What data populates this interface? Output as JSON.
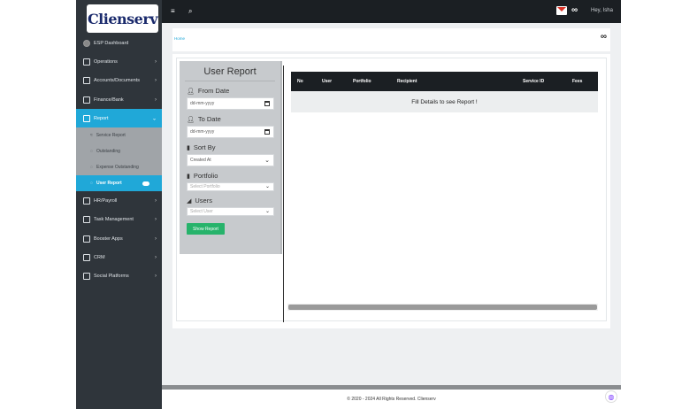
{
  "brand": {
    "logo_text": "Clienserv"
  },
  "topbar": {
    "menu_icon": "≡",
    "search_icon": "⌕",
    "mail_icon": "gmail-icon",
    "link_icon": "🔗",
    "greeting": "Hey, Isha"
  },
  "sidebar": {
    "items": [
      {
        "label": "ESP Dashboard",
        "icon": "dashboard-icon",
        "has_chevron": false
      },
      {
        "label": "Operations",
        "icon": "document-icon",
        "has_chevron": true
      },
      {
        "label": "Accounts/Documents",
        "icon": "document-icon",
        "has_chevron": true
      },
      {
        "label": "Finance/Bank",
        "icon": "document-icon",
        "has_chevron": true
      },
      {
        "label": "Report",
        "icon": "document-icon",
        "has_chevron": true,
        "active": true
      },
      {
        "label": "HR/Payroll",
        "icon": "document-icon",
        "has_chevron": true
      },
      {
        "label": "Task Management",
        "icon": "document-icon",
        "has_chevron": true
      },
      {
        "label": "Booster Apps",
        "icon": "document-icon",
        "has_chevron": true
      },
      {
        "label": "CRM",
        "icon": "document-icon",
        "has_chevron": true
      },
      {
        "label": "Social Platforms",
        "icon": "document-icon",
        "has_chevron": true
      }
    ],
    "report_submenu": [
      {
        "label": "Service Report",
        "icon": "≈"
      },
      {
        "label": "Outstanding",
        "icon": "◌"
      },
      {
        "label": "Expense Outstanding",
        "icon": "◌"
      },
      {
        "label": "User Report",
        "icon": "◌",
        "current": true
      }
    ]
  },
  "breadcrumb": {
    "home": "Home",
    "link_icon": "🔗"
  },
  "filter": {
    "title": "User Report",
    "from_date_label": "From Date",
    "from_date_value": "dd-mm-yyyy",
    "to_date_label": "To Date",
    "to_date_value": "dd-mm-yyyy",
    "sort_by_label": "Sort By",
    "sort_by_value": "Created At",
    "portfolio_label": "Portfolio",
    "portfolio_placeholder": "Select Portfolio",
    "users_label": "Users",
    "users_placeholder": "Select User",
    "show_button": "Show Report"
  },
  "table": {
    "headers": [
      "No",
      "User",
      "Portfolio",
      "Recipient",
      "Service ID",
      "Fees"
    ],
    "empty_message": "Fill Details to see Report !"
  },
  "footer": {
    "text": "© 2020 - 2024 All Rights Reserved.  Clienserv"
  }
}
